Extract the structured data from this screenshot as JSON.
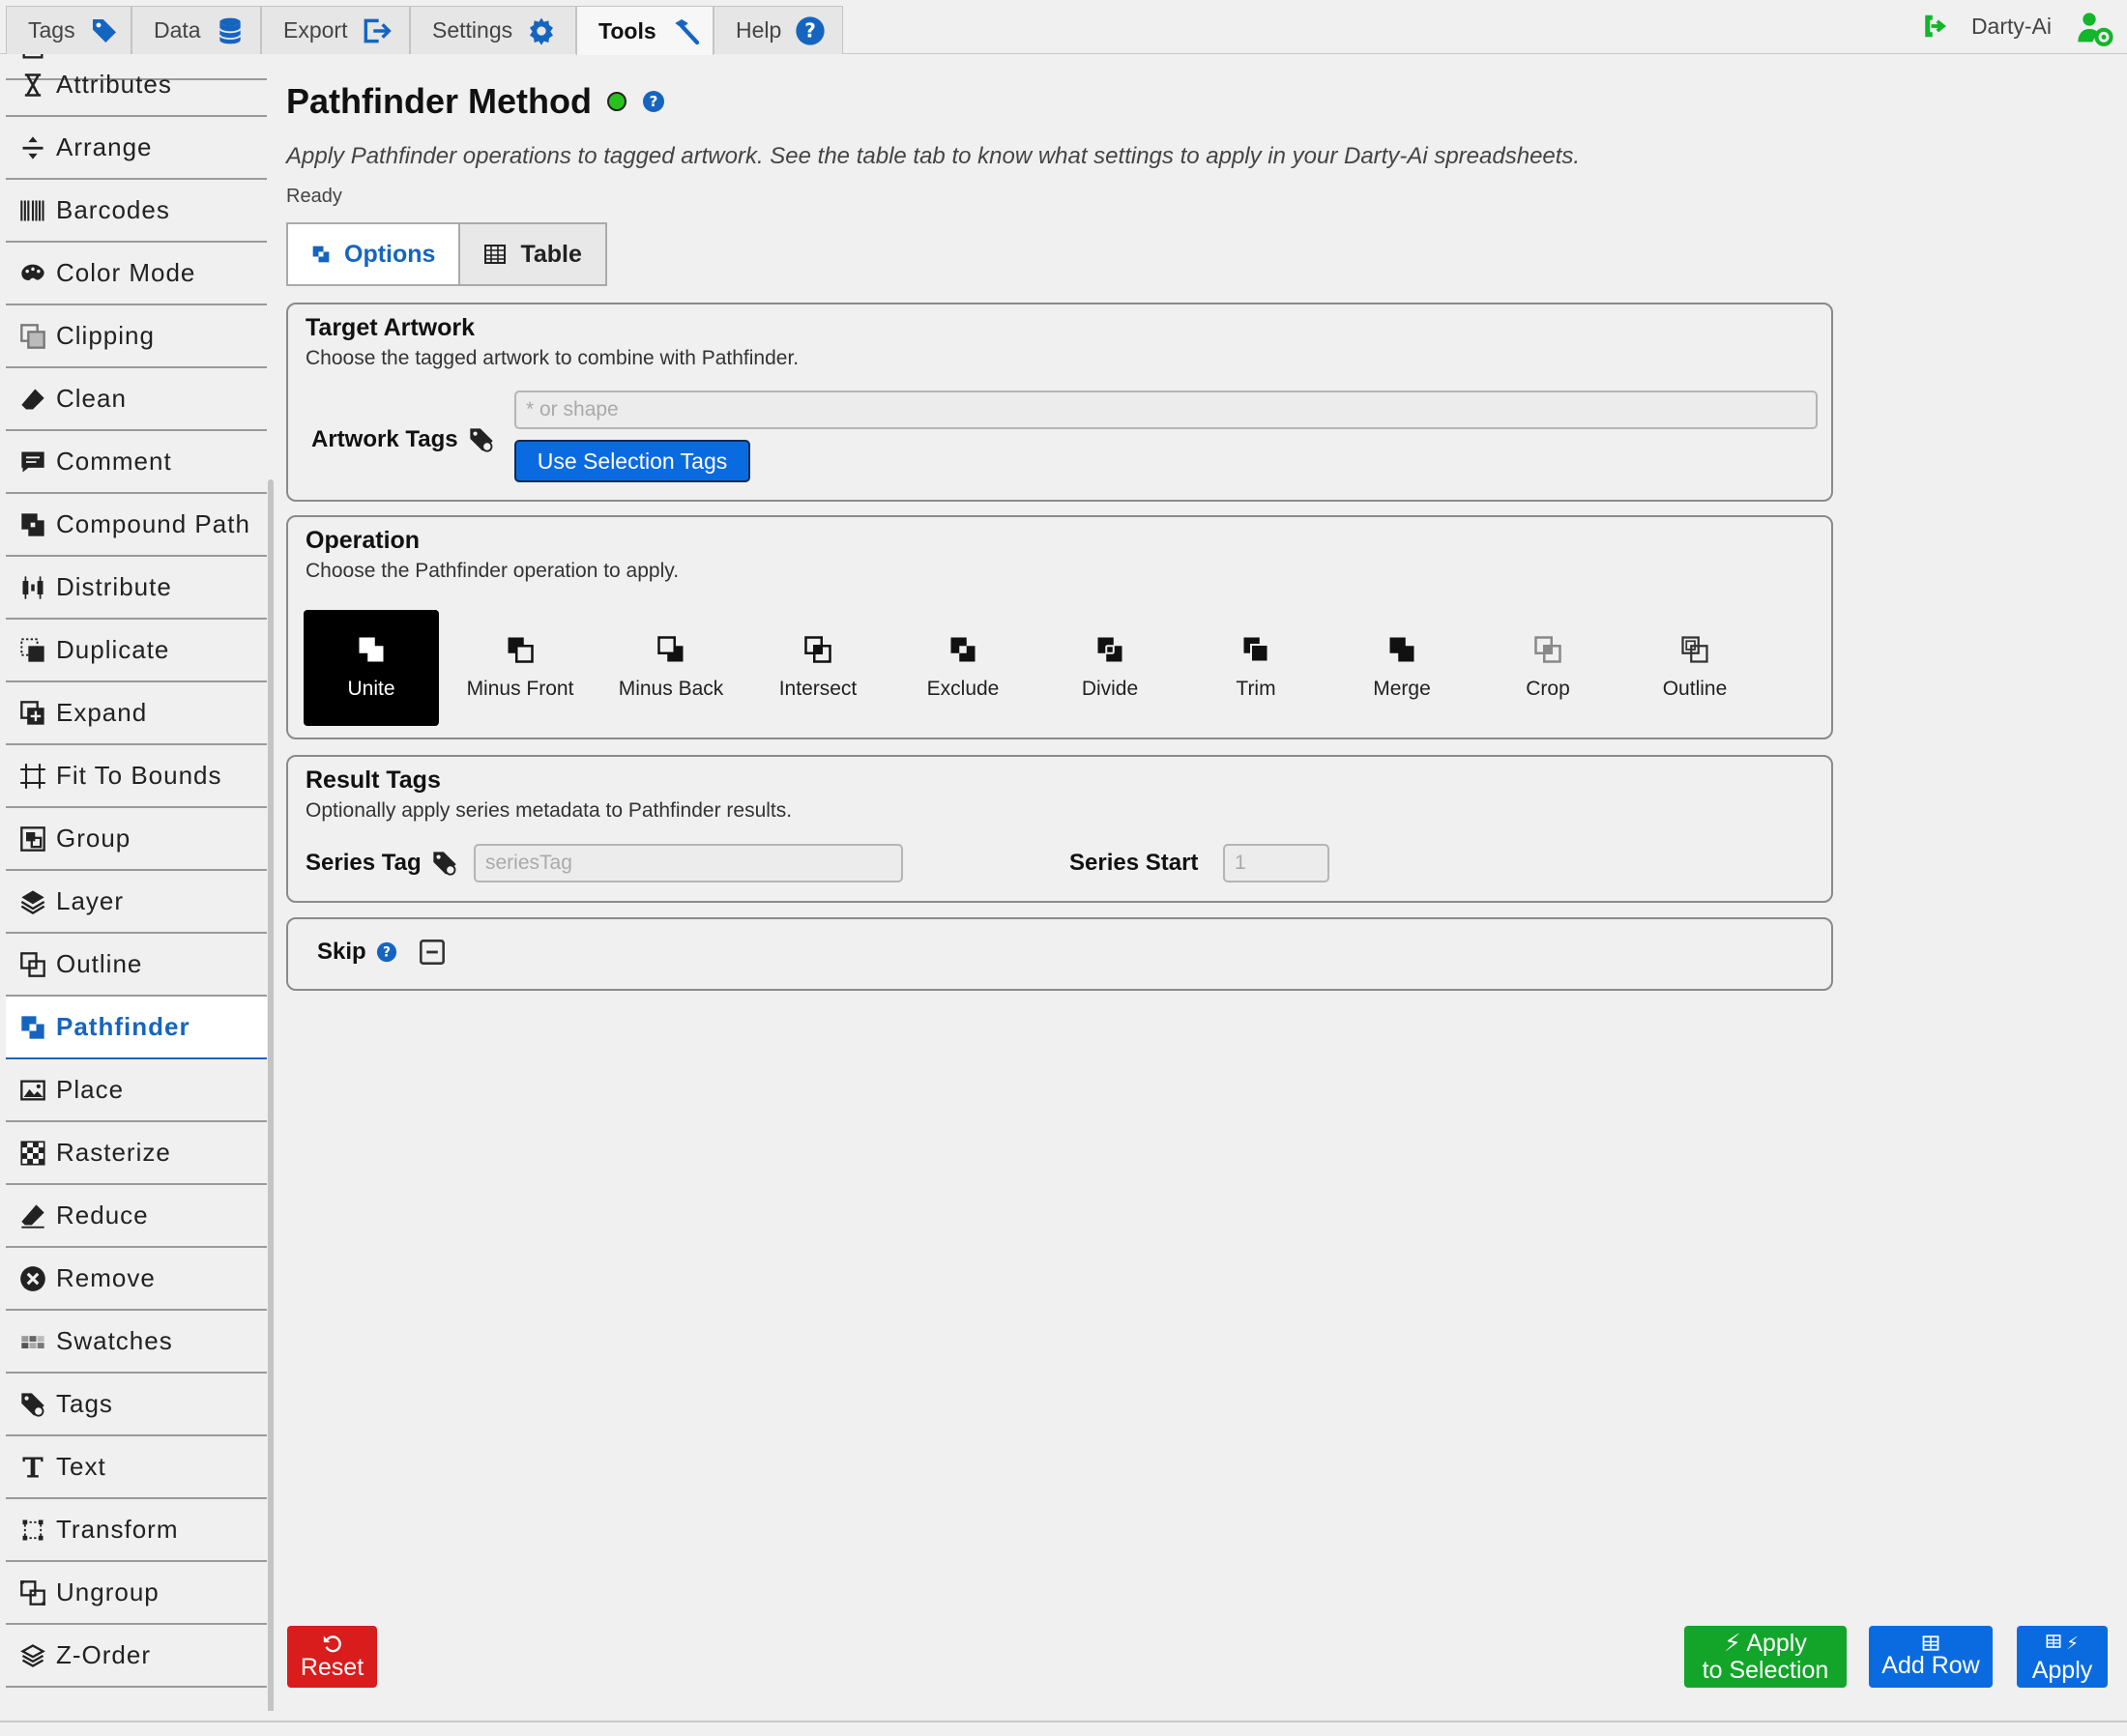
{
  "topnav": {
    "tabs": [
      {
        "label": "Tags",
        "icon": "tag-icon"
      },
      {
        "label": "Data",
        "icon": "database-icon"
      },
      {
        "label": "Export",
        "icon": "export-icon"
      },
      {
        "label": "Settings",
        "icon": "gear-icon"
      },
      {
        "label": "Tools",
        "icon": "hammer-icon",
        "active": true
      },
      {
        "label": "Help",
        "icon": "help-icon"
      }
    ],
    "user": "Darty-Ai"
  },
  "sidebar": {
    "items": [
      {
        "label": "Attributes"
      },
      {
        "label": "Arrange"
      },
      {
        "label": "Barcodes"
      },
      {
        "label": "Color Mode"
      },
      {
        "label": "Clipping"
      },
      {
        "label": "Clean"
      },
      {
        "label": "Comment"
      },
      {
        "label": "Compound Path"
      },
      {
        "label": "Distribute"
      },
      {
        "label": "Duplicate"
      },
      {
        "label": "Expand"
      },
      {
        "label": "Fit To Bounds"
      },
      {
        "label": "Group"
      },
      {
        "label": "Layer"
      },
      {
        "label": "Outline"
      },
      {
        "label": "Pathfinder",
        "active": true
      },
      {
        "label": "Place"
      },
      {
        "label": "Rasterize"
      },
      {
        "label": "Reduce"
      },
      {
        "label": "Remove"
      },
      {
        "label": "Swatches"
      },
      {
        "label": "Tags"
      },
      {
        "label": "Text"
      },
      {
        "label": "Transform"
      },
      {
        "label": "Ungroup"
      },
      {
        "label": "Z-Order"
      }
    ]
  },
  "main": {
    "title": "Pathfinder Method",
    "description": "Apply Pathfinder operations to tagged artwork. See the table tab to know what settings to apply in your Darty-Ai spreadsheets.",
    "status": "Ready",
    "tabs": [
      {
        "label": "Options",
        "active": true
      },
      {
        "label": "Table"
      }
    ],
    "target": {
      "title": "Target Artwork",
      "subtitle": "Choose the tagged artwork to combine with Pathfinder.",
      "field_label": "Artwork Tags",
      "placeholder": "* or shape",
      "button": "Use Selection Tags"
    },
    "operation": {
      "title": "Operation",
      "subtitle": "Choose the Pathfinder operation to apply.",
      "options": [
        "Unite",
        "Minus Front",
        "Minus Back",
        "Intersect",
        "Exclude",
        "Divide",
        "Trim",
        "Merge",
        "Crop",
        "Outline"
      ],
      "selected": "Unite"
    },
    "result": {
      "title": "Result Tags",
      "subtitle": "Optionally apply series metadata to Pathfinder results.",
      "series_tag_label": "Series Tag",
      "series_tag_placeholder": "seriesTag",
      "series_start_label": "Series Start",
      "series_start_placeholder": "1"
    },
    "skip": {
      "label": "Skip"
    }
  },
  "footer": {
    "reset_label": "Reset",
    "apply_selection_line1": "Apply",
    "apply_selection_line2": "to Selection",
    "add_row_label": "Add Row",
    "apply_label": "Apply"
  },
  "colors": {
    "accent": "#1565c0",
    "primary_button": "#0a6be0",
    "reset": "#d91c1c",
    "green": "#13a52a",
    "blue": "#0a6be0",
    "status_ok": "#28c21c"
  }
}
